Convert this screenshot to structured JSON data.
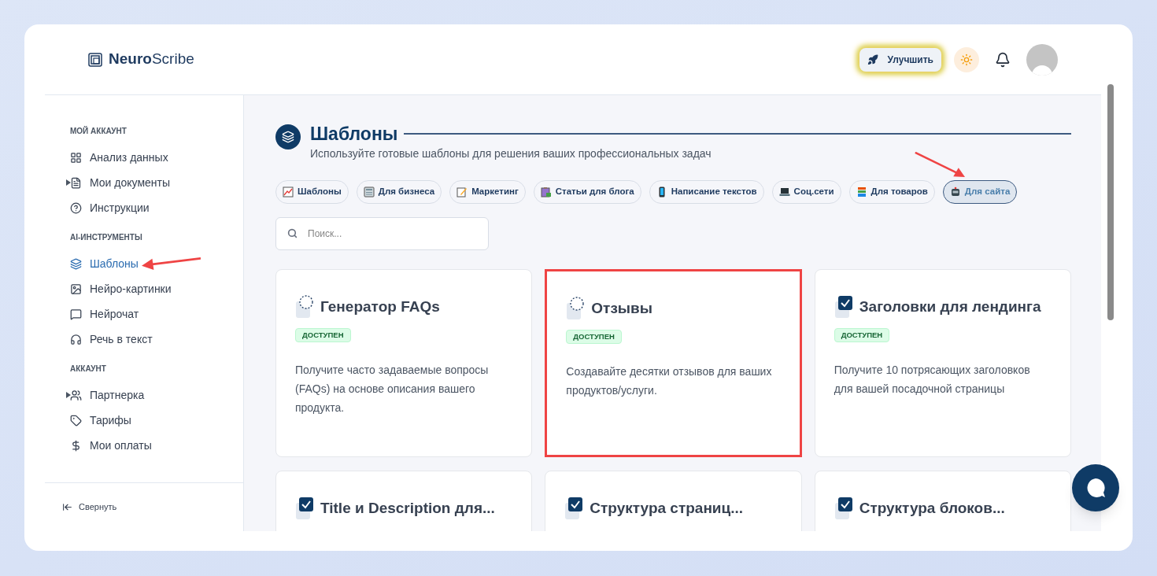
{
  "header": {
    "logo": {
      "first": "Neuro",
      "second": "Scribe"
    },
    "upgrade_button": "Улучшить"
  },
  "sidebar": {
    "sections": [
      {
        "title": "МОЙ АККАУНТ",
        "items": [
          {
            "label": "Анализ данных",
            "selected": false
          },
          {
            "label": "Мои документы",
            "selected": false,
            "expanded": false
          },
          {
            "label": "Инструкции",
            "selected": false
          }
        ]
      },
      {
        "title": "AI-ИНСТРУМЕНТЫ",
        "items": [
          {
            "label": "Шаблоны",
            "selected": true,
            "annotated": true
          },
          {
            "label": "Нейро-картинки",
            "selected": false
          },
          {
            "label": "Нейрочат",
            "selected": false
          },
          {
            "label": "Речь в текст",
            "selected": false
          }
        ]
      },
      {
        "title": "АККАУНТ",
        "items": [
          {
            "label": "Партнерка",
            "selected": false,
            "expanded": false
          },
          {
            "label": "Тарифы",
            "selected": false
          },
          {
            "label": "Мои оплаты",
            "selected": false
          }
        ]
      }
    ],
    "collapse_button": "Свернуть"
  },
  "page": {
    "title": "Шаблоны",
    "subtitle": "Используйте готовые шаблоны для решения ваших профессиональных задач"
  },
  "categories": [
    {
      "label": "Шаблоны",
      "selected": false
    },
    {
      "label": "Для бизнеса",
      "selected": false
    },
    {
      "label": "Маркетинг",
      "selected": false
    },
    {
      "label": "Статьи для блога",
      "selected": false
    },
    {
      "label": "Написание текстов",
      "selected": false
    },
    {
      "label": "Соц.сети",
      "selected": false
    },
    {
      "label": "Для товаров",
      "selected": false
    },
    {
      "label": "Для сайта",
      "selected": true,
      "annotated": true
    }
  ],
  "search": {
    "placeholder": "Поиск..."
  },
  "cards": [
    {
      "kind": "draft",
      "title": "Генератор FAQs",
      "badge": "ДОСТУПЕН",
      "description": "Получите часто задаваемые вопросы (FAQs) на основе описания вашего продукта.",
      "highlighted": false
    },
    {
      "kind": "draft",
      "title": "Отзывы",
      "badge": "ДОСТУПЕН",
      "description": "Создавайте десятки отзывов для ваших продуктов/услуги.",
      "highlighted": true
    },
    {
      "kind": "check",
      "title": "Заголовки для лендинга",
      "badge": "ДОСТУПЕН",
      "description": "Получите 10 потрясающих заголовков для вашей посадочной страницы",
      "highlighted": false
    },
    {
      "kind": "check",
      "title": "Title и Description для...",
      "highlighted": false
    },
    {
      "kind": "check",
      "title": "Структура страниц...",
      "highlighted": false
    },
    {
      "kind": "check",
      "title": "Структура блоков...",
      "highlighted": false
    }
  ]
}
